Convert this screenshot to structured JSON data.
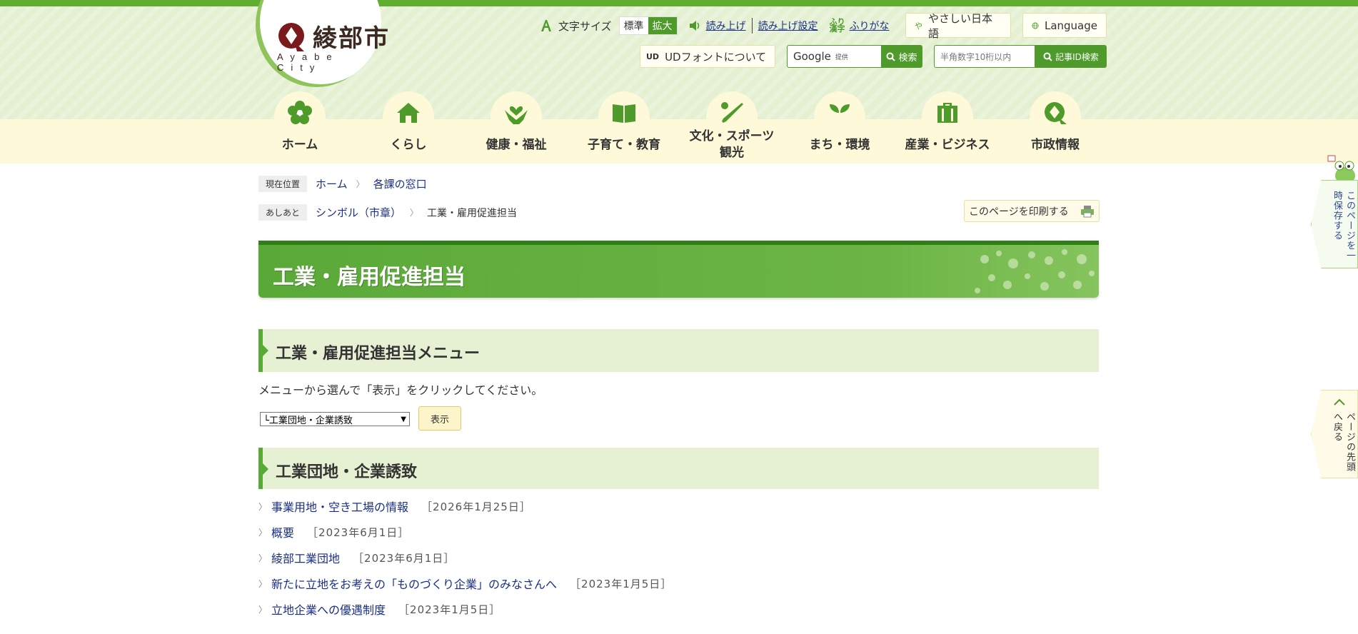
{
  "header": {
    "logo_text": "綾部市",
    "logo_sub": "Ayabe City",
    "text_size_label": "文字サイズ",
    "text_size_standard": "標準",
    "text_size_large": "拡大",
    "read_aloud": "読み上げ",
    "read_settings": "読み上げ設定",
    "furigana": "ふりがな",
    "easy_japanese": "やさしい日本語",
    "language": "Language",
    "ud_font": "UDフォントについて",
    "google_label": "Google",
    "google_provided": "提供",
    "search_button": "検索",
    "id_placeholder": "半角数字10桁以内",
    "id_search_button": "記事ID検索"
  },
  "nav": [
    {
      "label": "ホーム",
      "icon": "plum-flower-icon"
    },
    {
      "label": "くらし",
      "icon": "house-icon"
    },
    {
      "label": "健康・福祉",
      "icon": "hands-heart-icon"
    },
    {
      "label": "子育て・教育",
      "icon": "book-icon"
    },
    {
      "label": "文化・スポーツ\n観光",
      "icon": "baseball-icon"
    },
    {
      "label": "まち・環境",
      "icon": "sprout-icon"
    },
    {
      "label": "産業・ビジネス",
      "icon": "briefcase-icon"
    },
    {
      "label": "市政情報",
      "icon": "city-logo-icon"
    }
  ],
  "breadcrumb": {
    "label": "現在位置",
    "items": [
      "ホーム",
      "各課の窓口"
    ]
  },
  "history": {
    "label": "あしあと",
    "items": [
      "シンボル（市章）"
    ],
    "current": "工業・雇用促進担当"
  },
  "print_button": "このページを印刷する",
  "page_title": "工業・雇用促進担当",
  "menu_section": {
    "heading": "工業・雇用促進担当メニュー",
    "description": "メニューから選んで「表示」をクリックしてください。",
    "select_value": "└工業団地・企業誘致",
    "show_button": "表示"
  },
  "list_section": {
    "heading": "工業団地・企業誘致",
    "items": [
      {
        "title": "事業用地・空き工場の情報",
        "date": "［2026年1月25日］"
      },
      {
        "title": "概要",
        "date": "［2023年6月1日］"
      },
      {
        "title": "綾部工業団地",
        "date": "［2023年6月1日］"
      },
      {
        "title": "新たに立地をお考えの「ものづくり企業」のみなさんへ",
        "date": "［2023年1月5日］"
      },
      {
        "title": "立地企業への優遇制度",
        "date": "［2023年1月5日］"
      }
    ]
  },
  "side": {
    "save_page": "このページを一時保存する",
    "back_to_top": "ページの先頭へ戻る"
  },
  "colors": {
    "brand_green": "#4e9a2b",
    "header_bg": "#e5f0d3",
    "nav_bg": "#fdf9d9"
  }
}
